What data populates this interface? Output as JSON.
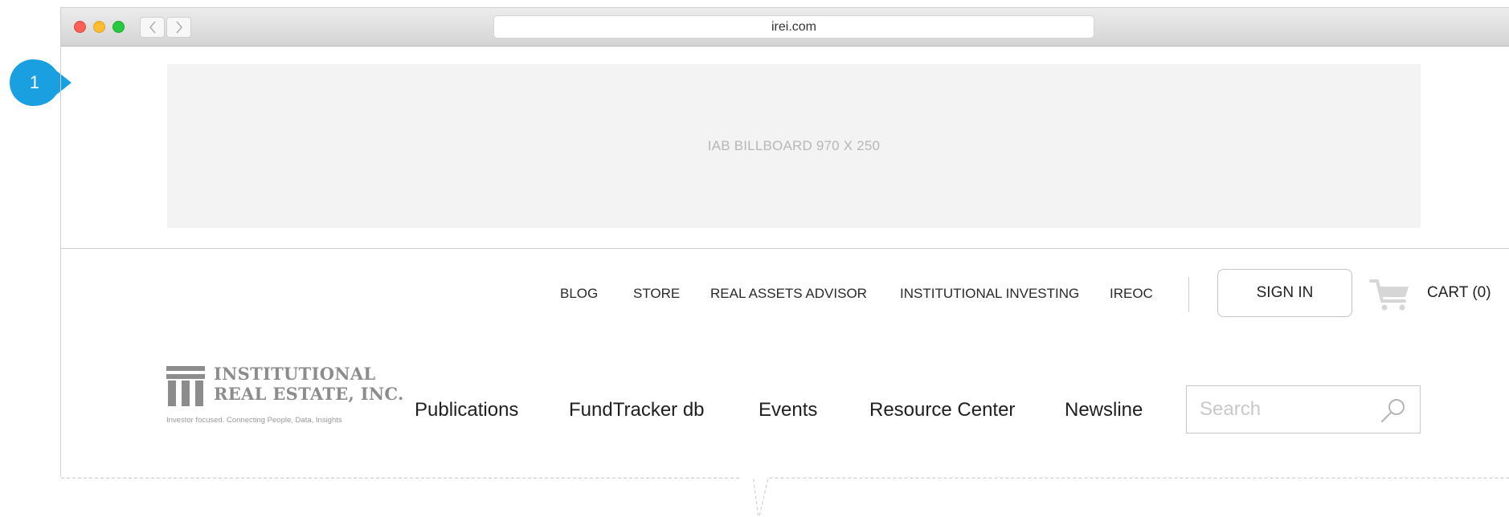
{
  "annotation": {
    "number": "1",
    "color": "#1a9fe0"
  },
  "browser": {
    "url": "irei.com",
    "back_icon": "chevron-left-icon",
    "forward_icon": "chevron-right-icon"
  },
  "ad": {
    "label": "IAB BILLBOARD 970 X 250"
  },
  "utility_nav": {
    "items": [
      "BLOG",
      "STORE",
      "REAL ASSETS ADVISOR",
      "INSTITUTIONAL INVESTING",
      "IREOC"
    ],
    "sign_in": "SIGN IN",
    "cart_icon": "cart-icon",
    "cart_label": "CART (0)"
  },
  "logo": {
    "line1": "INSTITUTIONAL",
    "line2": "REAL ESTATE, INC.",
    "tagline": "Investor focused. Connecting People, Data, Insights"
  },
  "main_nav": {
    "items": [
      "Publications",
      "FundTracker db",
      "Events",
      "Resource Center",
      "Newsline"
    ]
  },
  "search": {
    "placeholder": "Search",
    "icon": "search-icon"
  },
  "colors": {
    "accent": "#1a9fe0",
    "billboard_bg": "#f2f3f2",
    "logo_gray": "#8c8c8c"
  }
}
